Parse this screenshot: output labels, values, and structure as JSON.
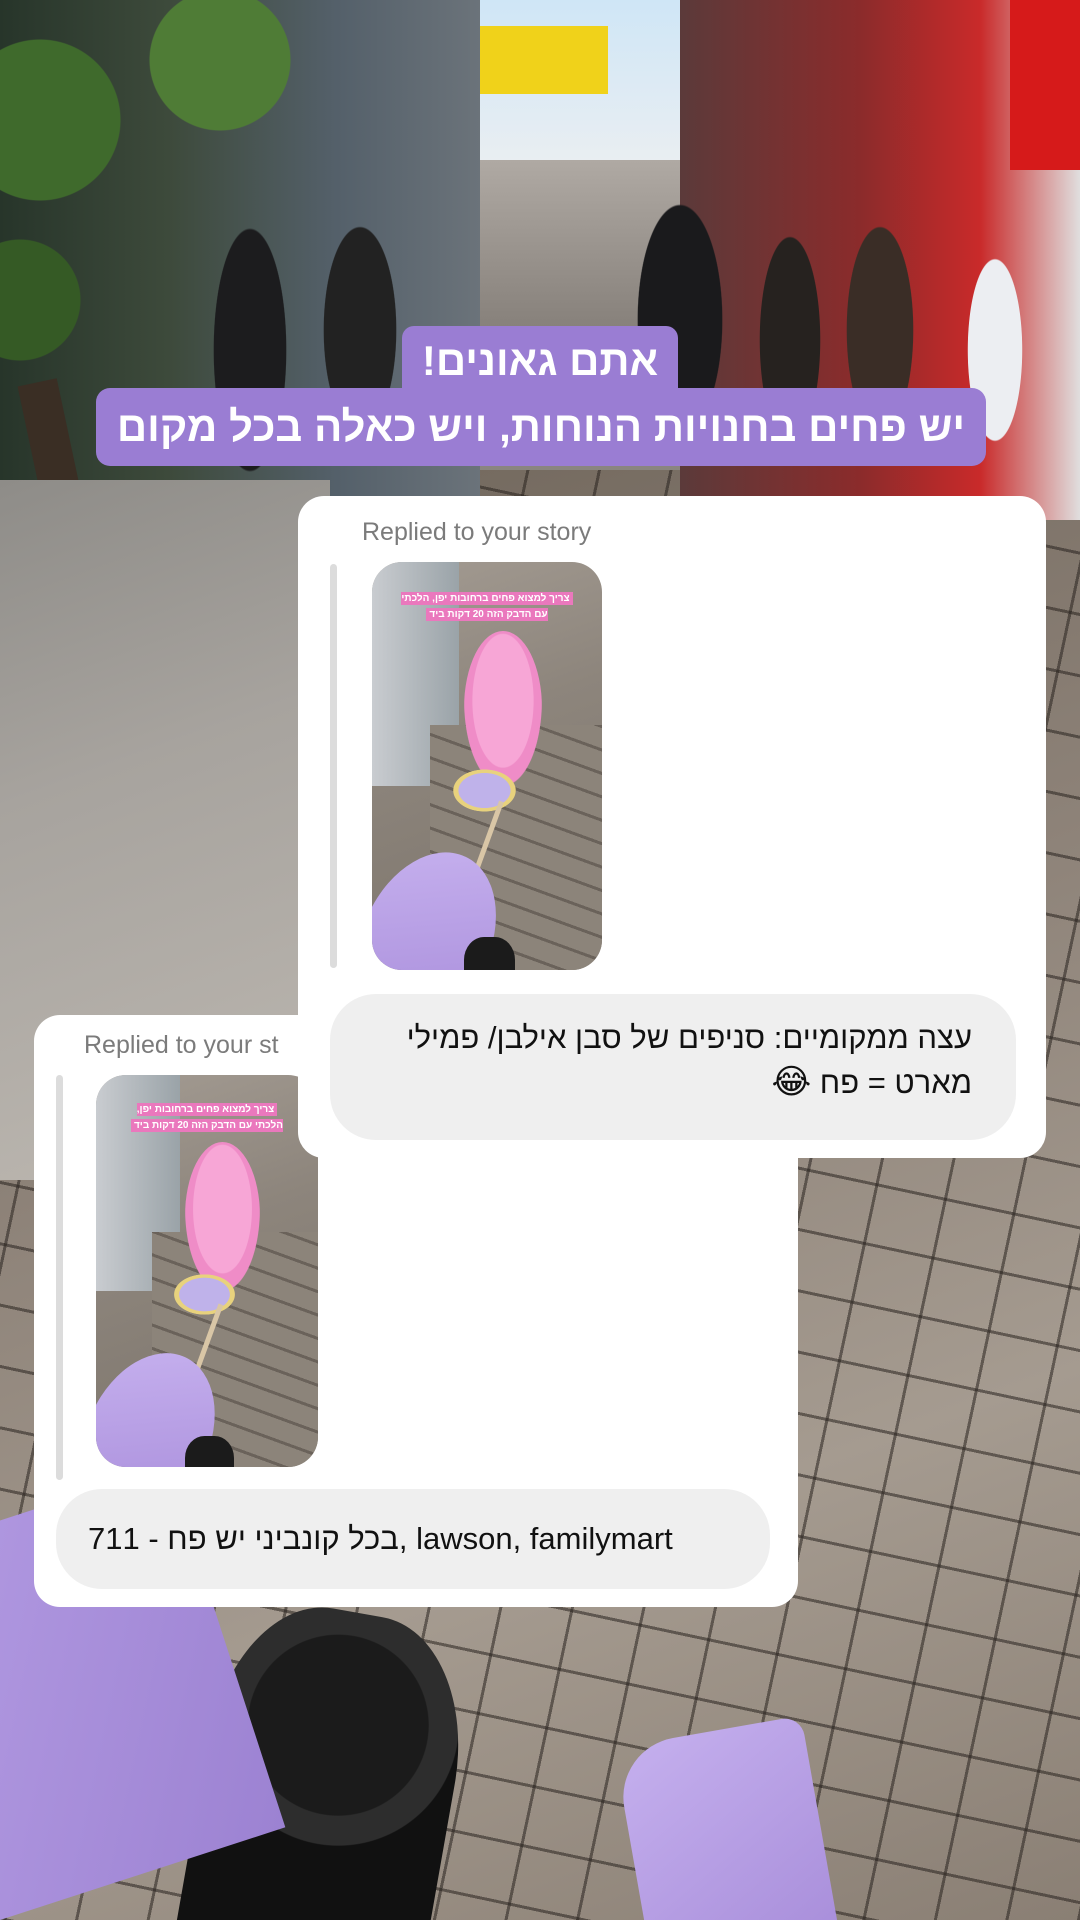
{
  "overlay": {
    "caption_line1": "אתם גאונים!",
    "caption_line2": "יש פחים בחנויות הנוחות, ויש כאלה בכל מקום",
    "caption_color": "#9a7dd3"
  },
  "replies": [
    {
      "label": "Replied to your story",
      "thumbnail": {
        "description_icon": "story-thumbnail-cotton-candy",
        "overlay_text": "צריך למצוא פחים ברחובות יפן, הלכתי עם הדבק הזה 20 דקות ביד"
      },
      "message_text": "עצה ממקומיים: סניפים של סבן אילבן/ פמילי מארט = פח",
      "message_emoji": "😂"
    },
    {
      "label": "Replied to your st",
      "thumbnail": {
        "description_icon": "story-thumbnail-cotton-candy",
        "overlay_text": "צריך למצוא פחים ברחובות יפן, הלכתי עם הדבק הזה 20 דקות ביד"
      },
      "message_text": "בכל קונביני יש פח - 711, lawson, familymart"
    }
  ]
}
